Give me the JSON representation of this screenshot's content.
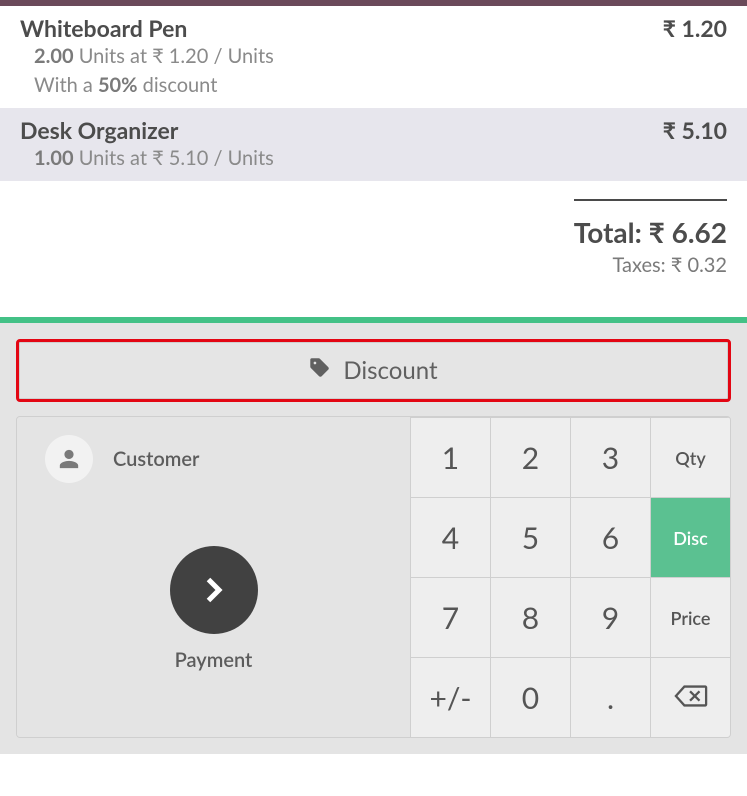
{
  "orderlines": [
    {
      "name": "Whiteboard Pen",
      "price": "₹ 1.20",
      "qty": "2.00",
      "unit_label": "Units at",
      "rate": "₹ 1.20 / Units",
      "discount_prefix": "With a ",
      "discount_value": "50%",
      "discount_suffix": " discount",
      "selected": false
    },
    {
      "name": "Desk Organizer",
      "price": "₹ 5.10",
      "qty": "1.00",
      "unit_label": "Units at",
      "rate": "₹ 5.10 / Units",
      "selected": true
    }
  ],
  "summary": {
    "total_label": "Total:",
    "total_value": "₹ 6.62",
    "taxes_label": "Taxes:",
    "taxes_value": "₹ 0.32"
  },
  "buttons": {
    "discount": "Discount",
    "customer": "Customer",
    "payment": "Payment"
  },
  "numpad": {
    "keys": [
      "1",
      "2",
      "3",
      "4",
      "5",
      "6",
      "7",
      "8",
      "9",
      "+/-",
      "0",
      "."
    ],
    "mode_qty": "Qty",
    "mode_disc": "Disc",
    "mode_price": "Price",
    "active_mode": "Disc"
  }
}
